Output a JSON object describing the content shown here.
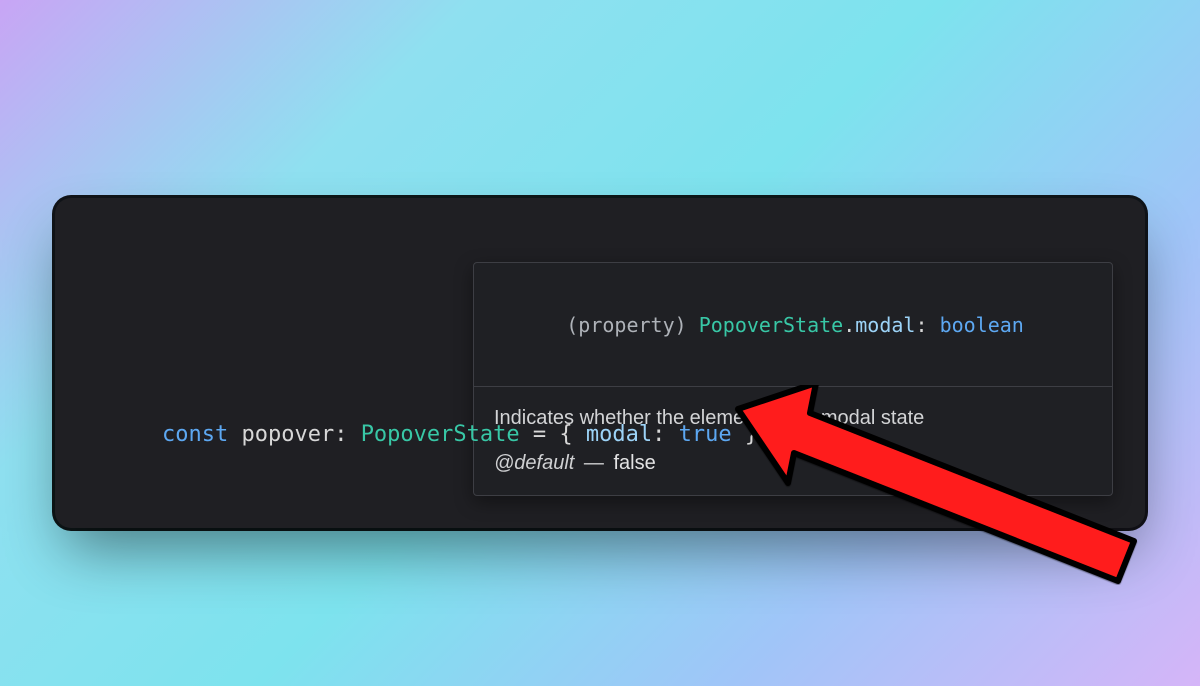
{
  "code": {
    "keyword_const": "const",
    "variable": "popover",
    "type": "PopoverState",
    "equals_open": " = { ",
    "prop_name": "modal",
    "prop_colon": ": ",
    "prop_value": "true",
    "close": " }"
  },
  "hover": {
    "sig": {
      "prefix": "(property) ",
      "owner_type": "PopoverState",
      "dot": ".",
      "member": "modal",
      "colon": ": ",
      "value_type": "boolean"
    },
    "description": "Indicates whether the element has a modal state",
    "default_tag": "@default",
    "default_dash": " — ",
    "default_value": "false"
  }
}
